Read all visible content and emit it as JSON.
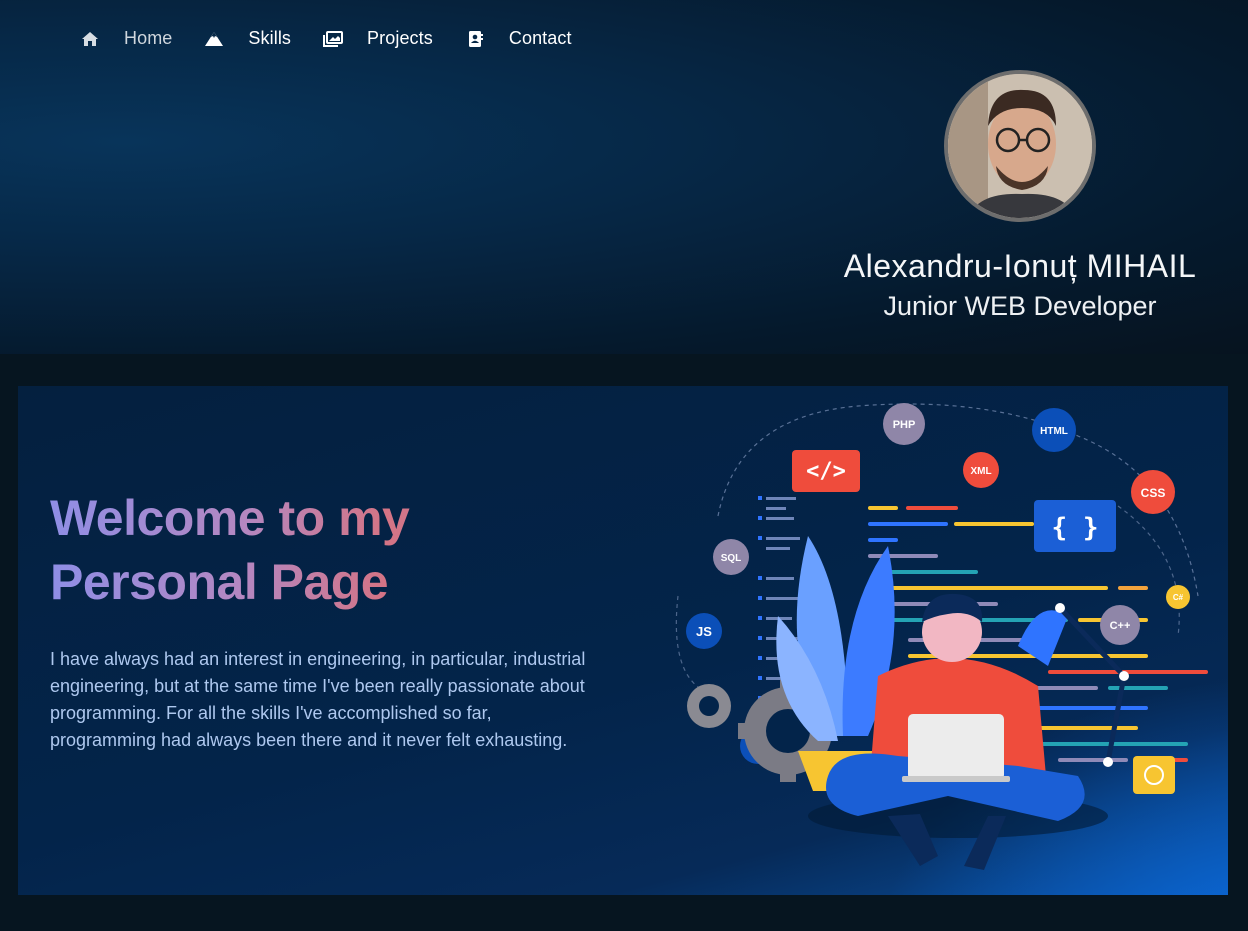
{
  "nav": {
    "items": [
      {
        "label": "Home",
        "icon": "home-icon",
        "active": true
      },
      {
        "label": "Skills",
        "icon": "mountain-icon",
        "active": false
      },
      {
        "label": "Projects",
        "icon": "images-icon",
        "active": false
      },
      {
        "label": "Contact",
        "icon": "address-book-icon",
        "active": false
      }
    ]
  },
  "profile": {
    "name": "Alexandru-Ionuț MIHAIL",
    "role": "Junior WEB Developer"
  },
  "hero": {
    "title": "Welcome to my Personal Page",
    "text": "I have always had an interest in engineering, in particular, industrial engineering, but at the same time I've been really passionate about programming. For all the skills I've accomplished so far, programming had always been there and it never felt exhausting.",
    "illustration_tags": [
      "PHP",
      "HTML",
      "XML",
      "CSS",
      "SQL",
      "JS",
      "C#",
      "C++",
      "C#"
    ],
    "code_symbol": "</>",
    "braces": "{ }"
  },
  "colors": {
    "accent_red": "#ef4c3c",
    "accent_blue": "#0b4fb8",
    "title_gradient_start": "#8f8ee6",
    "title_gradient_mid": "#d47485"
  }
}
